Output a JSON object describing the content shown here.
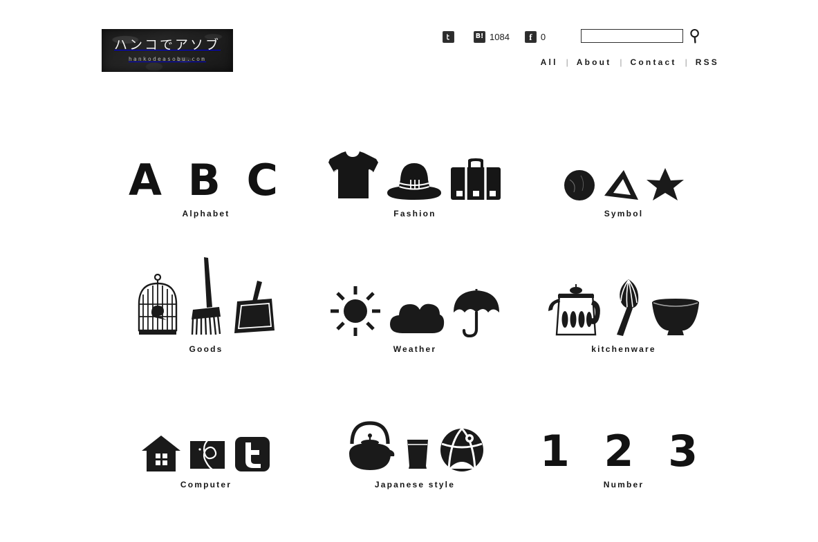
{
  "site": {
    "logo_main": "ハンコでアソブ",
    "logo_sub": "hankodeasobu.com"
  },
  "header": {
    "social": [
      {
        "name": "twitter",
        "glyph": "t",
        "count": ""
      },
      {
        "name": "hatena-bookmark",
        "glyph": "B!",
        "count": "1084"
      },
      {
        "name": "facebook",
        "glyph": "f",
        "count": "0"
      }
    ],
    "search": {
      "value": "",
      "placeholder": "",
      "icon": "search-icon"
    },
    "nav": [
      {
        "label": "All"
      },
      {
        "label": "About"
      },
      {
        "label": "Contact"
      },
      {
        "label": "RSS"
      }
    ],
    "nav_separator": "|"
  },
  "categories": [
    {
      "label": "Alphabet",
      "items": "A B C",
      "icons": [
        "letter-a",
        "letter-b",
        "letter-c"
      ]
    },
    {
      "label": "Fashion",
      "items": "t-shirt, hat, suitcase",
      "icons": [
        "tshirt-icon",
        "hat-icon",
        "suitcase-icon"
      ]
    },
    {
      "label": "Symbol",
      "items": "circle, triangle, star",
      "icons": [
        "circle-icon",
        "triangle-icon",
        "star-icon"
      ]
    },
    {
      "label": "Goods",
      "items": "birdcage, broom, dustpan",
      "icons": [
        "birdcage-icon",
        "broom-icon",
        "dustpan-icon"
      ]
    },
    {
      "label": "Weather",
      "items": "sun, cloud, umbrella",
      "icons": [
        "sun-icon",
        "cloud-icon",
        "umbrella-icon"
      ]
    },
    {
      "label": "kitchenware",
      "items": "kettle, whisk, bowl",
      "icons": [
        "kettle-icon",
        "whisk-icon",
        "bowl-icon"
      ]
    },
    {
      "label": "Computer",
      "items": "house, mail, twitter",
      "icons": [
        "house-icon",
        "mail-icon",
        "twitter-square-icon"
      ]
    },
    {
      "label": "Japanese style",
      "items": "teapot, teacup, temari ball",
      "icons": [
        "teapot-icon",
        "teacup-icon",
        "temari-ball-icon"
      ]
    },
    {
      "label": "Number",
      "items": "1 2 3",
      "icons": [
        "digit-1",
        "digit-2",
        "digit-3"
      ]
    }
  ],
  "colors": {
    "ink": "#121212",
    "background": "#ffffff",
    "separator": "#9a9a9a"
  }
}
